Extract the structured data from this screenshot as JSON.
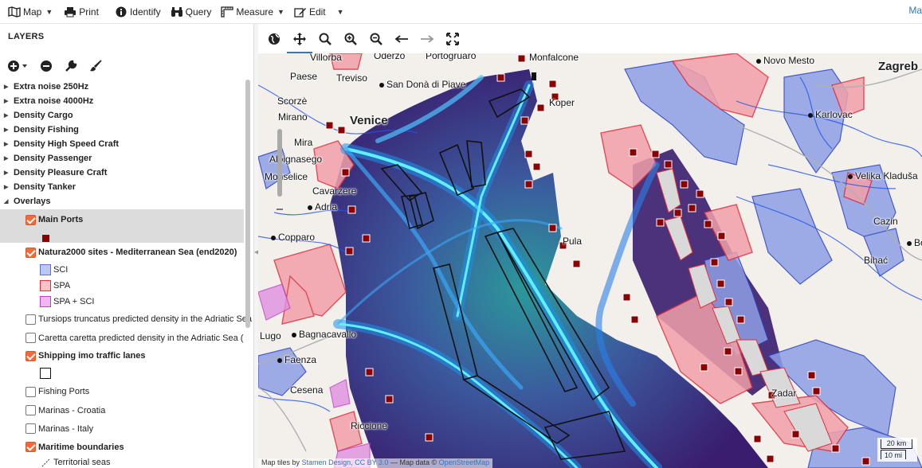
{
  "toolbar": {
    "map_label": "Map",
    "print_label": "Print",
    "identify_label": "Identify",
    "query_label": "Query",
    "measure_label": "Measure",
    "edit_label": "Edit",
    "right_link": "Ma"
  },
  "panel": {
    "title": "LAYERS",
    "groups": [
      {
        "label": "Extra noise 250Hz"
      },
      {
        "label": "Extra noise 4000Hz"
      },
      {
        "label": "Density Cargo"
      },
      {
        "label": "Density Fishing"
      },
      {
        "label": "Density High Speed Craft"
      },
      {
        "label": "Density Passenger"
      },
      {
        "label": "Density Pleasure Craft"
      },
      {
        "label": "Density Tanker"
      },
      {
        "label": "Overlays"
      }
    ],
    "overlays": {
      "main_ports": "Main Ports",
      "natura": "Natura2000 sites - Mediterranean Sea (end2020)",
      "sci": "SCI",
      "spa": "SPA",
      "spa_sci": "SPA + SCI",
      "tursiops": "Tursiops truncatus predicted density in the Adriatic Sea (",
      "caretta": "Caretta caretta predicted density in the Adriatic Sea (",
      "shipping": "Shipping imo traffic lanes",
      "fishing_ports": "Fishing Ports",
      "marinas_hr": "Marinas - Croatia",
      "marinas_it": "Marinas - Italy",
      "maritime": "Maritime boundaries",
      "territorial": "Territorial seas"
    }
  },
  "map": {
    "cities": {
      "villorba": "Villorba",
      "oderzo": "Oderzo",
      "portogruaro": "Portogruaro",
      "monfalcone": "Monfalcone",
      "novo_mesto": "Novo Mesto",
      "zagreb": "Zagreb",
      "paese": "Paese",
      "treviso": "Treviso",
      "san_dona": "San Donà di Piave",
      "koper": "Koper",
      "scorze": "Scorzè",
      "mirano": "Mirano",
      "venice": "Venice",
      "karlovac": "Karlovac",
      "mira": "Mira",
      "albignasego": "Albignasego",
      "velika": "Velika Kladuša",
      "monselice": "Monselice",
      "cavarzere": "Cavarzere",
      "adria": "Adria",
      "cazin": "Cazin",
      "bos": "Bos",
      "pula": "Pula",
      "copparo": "Copparo",
      "bihac": "Bihać",
      "lugo": "Lugo",
      "bagnacavallo": "Bagnacavallo",
      "faenza": "Faenza",
      "cesena": "Cesena",
      "zadar": "Zadar",
      "riccione": "Riccione"
    },
    "scale_km": "20 km",
    "scale_mi": "10 mi",
    "attribution_prefix": "Map tiles by",
    "attribution_stamen": "Stamen Design, CC BY 3.0",
    "attribution_mid": "— Map data ©",
    "attribution_osm": "OpenStreetMap"
  },
  "colors": {
    "accent": "#2a78c8",
    "checkbox": "#f06a3a",
    "port": "#8b0000",
    "sci_fill": "#8d9fe6",
    "spa_fill": "#f2a0aa",
    "spa_sci_fill": "#e090e0"
  }
}
